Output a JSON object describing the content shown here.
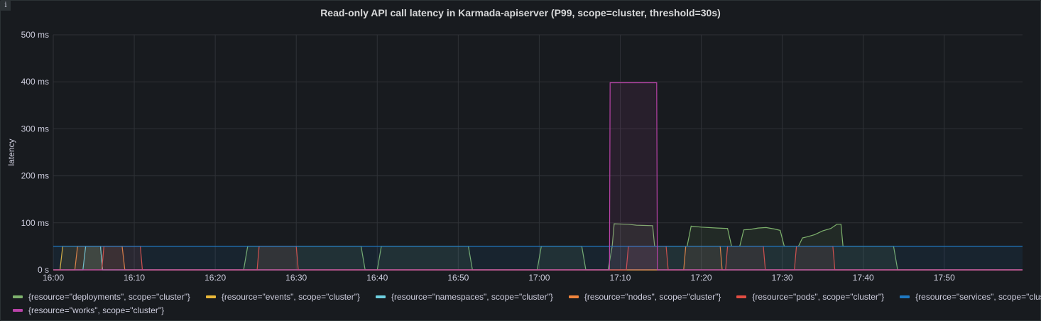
{
  "panel": {
    "title": "Read-only API call latency in Karmada-apiserver (P99, scope=cluster, threshold=30s)",
    "info_icon": "info-icon"
  },
  "chart_data": {
    "type": "line",
    "title": "Read-only API call latency in Karmada-apiserver (P99, scope=cluster, threshold=30s)",
    "xlabel": "",
    "ylabel": "latency",
    "xlim": [
      "16:00:00",
      "17:59:40"
    ],
    "ylim": [
      0,
      500
    ],
    "y_unit": "ms",
    "yticks": [
      "0 s",
      "100 ms",
      "200 ms",
      "300 ms",
      "400 ms",
      "500 ms"
    ],
    "ytick_values": [
      0,
      100,
      200,
      300,
      400,
      500
    ],
    "xticks": [
      "16:00",
      "16:10",
      "16:20",
      "16:30",
      "16:40",
      "16:50",
      "17:00",
      "17:10",
      "17:20",
      "17:30",
      "17:40",
      "17:50"
    ],
    "grid": true,
    "legend_position": "bottom",
    "fill": true,
    "series": [
      {
        "name": "{resource=\"deployments\", scope=\"cluster\"}",
        "color": "#7EB26D",
        "points": [
          [
            "16:00:00",
            0
          ],
          [
            "16:23:30",
            0
          ],
          [
            "16:24:00",
            50
          ],
          [
            "16:38:00",
            50
          ],
          [
            "16:38:30",
            0
          ],
          [
            "16:40:00",
            0
          ],
          [
            "16:40:30",
            50
          ],
          [
            "16:51:15",
            50
          ],
          [
            "16:51:45",
            0
          ],
          [
            "16:59:45",
            0
          ],
          [
            "17:00:15",
            50
          ],
          [
            "17:05:15",
            50
          ],
          [
            "17:05:45",
            0
          ],
          [
            "17:08:30",
            0
          ],
          [
            "17:09:00",
            50
          ],
          [
            "17:09:15",
            98
          ],
          [
            "17:11:00",
            97
          ],
          [
            "17:12:00",
            95
          ],
          [
            "17:14:00",
            94
          ],
          [
            "17:14:15",
            50
          ],
          [
            "17:18:15",
            50
          ],
          [
            "17:18:45",
            93
          ],
          [
            "17:20:00",
            91
          ],
          [
            "17:22:00",
            89
          ],
          [
            "17:23:15",
            88
          ],
          [
            "17:23:45",
            50
          ],
          [
            "17:24:45",
            50
          ],
          [
            "17:25:15",
            85
          ],
          [
            "17:26:00",
            86
          ],
          [
            "17:27:00",
            89
          ],
          [
            "17:28:00",
            90
          ],
          [
            "17:29:00",
            87
          ],
          [
            "17:29:45",
            84
          ],
          [
            "17:30:15",
            50
          ],
          [
            "17:32:00",
            50
          ],
          [
            "17:32:30",
            68
          ],
          [
            "17:33:00",
            70
          ],
          [
            "17:34:00",
            75
          ],
          [
            "17:35:00",
            83
          ],
          [
            "17:36:00",
            88
          ],
          [
            "17:36:45",
            97
          ],
          [
            "17:37:15",
            97
          ],
          [
            "17:37:30",
            50
          ],
          [
            "17:43:45",
            50
          ],
          [
            "17:44:15",
            0
          ],
          [
            "17:59:40",
            0
          ]
        ]
      },
      {
        "name": "{resource=\"events\", scope=\"cluster\"}",
        "color": "#EAB839",
        "points": [
          [
            "16:00:00",
            0
          ],
          [
            "16:00:50",
            0
          ],
          [
            "16:01:10",
            50
          ],
          [
            "16:05:50",
            50
          ],
          [
            "16:06:05",
            0
          ],
          [
            "17:59:40",
            0
          ]
        ]
      },
      {
        "name": "{resource=\"namespaces\", scope=\"cluster\"}",
        "color": "#6ED0E0",
        "points": [
          [
            "16:00:00",
            0
          ],
          [
            "16:03:40",
            0
          ],
          [
            "16:04:00",
            50
          ],
          [
            "16:05:50",
            50
          ],
          [
            "16:06:05",
            0
          ],
          [
            "17:59:40",
            0
          ]
        ]
      },
      {
        "name": "{resource=\"nodes\", scope=\"cluster\"}",
        "color": "#EF843C",
        "points": [
          [
            "16:00:00",
            0
          ],
          [
            "16:02:40",
            0
          ],
          [
            "16:03:00",
            50
          ],
          [
            "16:08:30",
            50
          ],
          [
            "16:08:50",
            0
          ],
          [
            "17:17:50",
            0
          ],
          [
            "17:18:05",
            50
          ],
          [
            "17:22:20",
            50
          ],
          [
            "17:22:35",
            0
          ],
          [
            "17:59:40",
            0
          ]
        ]
      },
      {
        "name": "{resource=\"pods\", scope=\"cluster\"}",
        "color": "#E24D42",
        "points": [
          [
            "16:00:00",
            0
          ],
          [
            "16:06:00",
            0
          ],
          [
            "16:06:15",
            50
          ],
          [
            "16:10:45",
            50
          ],
          [
            "16:11:00",
            0
          ],
          [
            "16:25:10",
            0
          ],
          [
            "16:25:25",
            50
          ],
          [
            "16:30:00",
            50
          ],
          [
            "16:30:15",
            0
          ],
          [
            "17:10:45",
            0
          ],
          [
            "17:11:00",
            50
          ],
          [
            "17:15:40",
            50
          ],
          [
            "17:15:55",
            0
          ],
          [
            "17:23:00",
            0
          ],
          [
            "17:23:15",
            50
          ],
          [
            "17:27:40",
            50
          ],
          [
            "17:27:55",
            0
          ],
          [
            "17:31:30",
            0
          ],
          [
            "17:31:45",
            50
          ],
          [
            "17:36:15",
            50
          ],
          [
            "17:36:30",
            0
          ],
          [
            "17:59:40",
            0
          ]
        ]
      },
      {
        "name": "{resource=\"services\", scope=\"cluster\"}",
        "color": "#1F78C1",
        "points": [
          [
            "16:00:00",
            50
          ],
          [
            "17:59:40",
            50
          ]
        ]
      },
      {
        "name": "{resource=\"works\", scope=\"cluster\"}",
        "color": "#BA43A9",
        "points": [
          [
            "16:00:00",
            0
          ],
          [
            "17:08:40",
            0
          ],
          [
            "17:08:45",
            398
          ],
          [
            "17:14:30",
            398
          ],
          [
            "17:14:35",
            0
          ],
          [
            "17:59:40",
            0
          ]
        ]
      }
    ]
  }
}
